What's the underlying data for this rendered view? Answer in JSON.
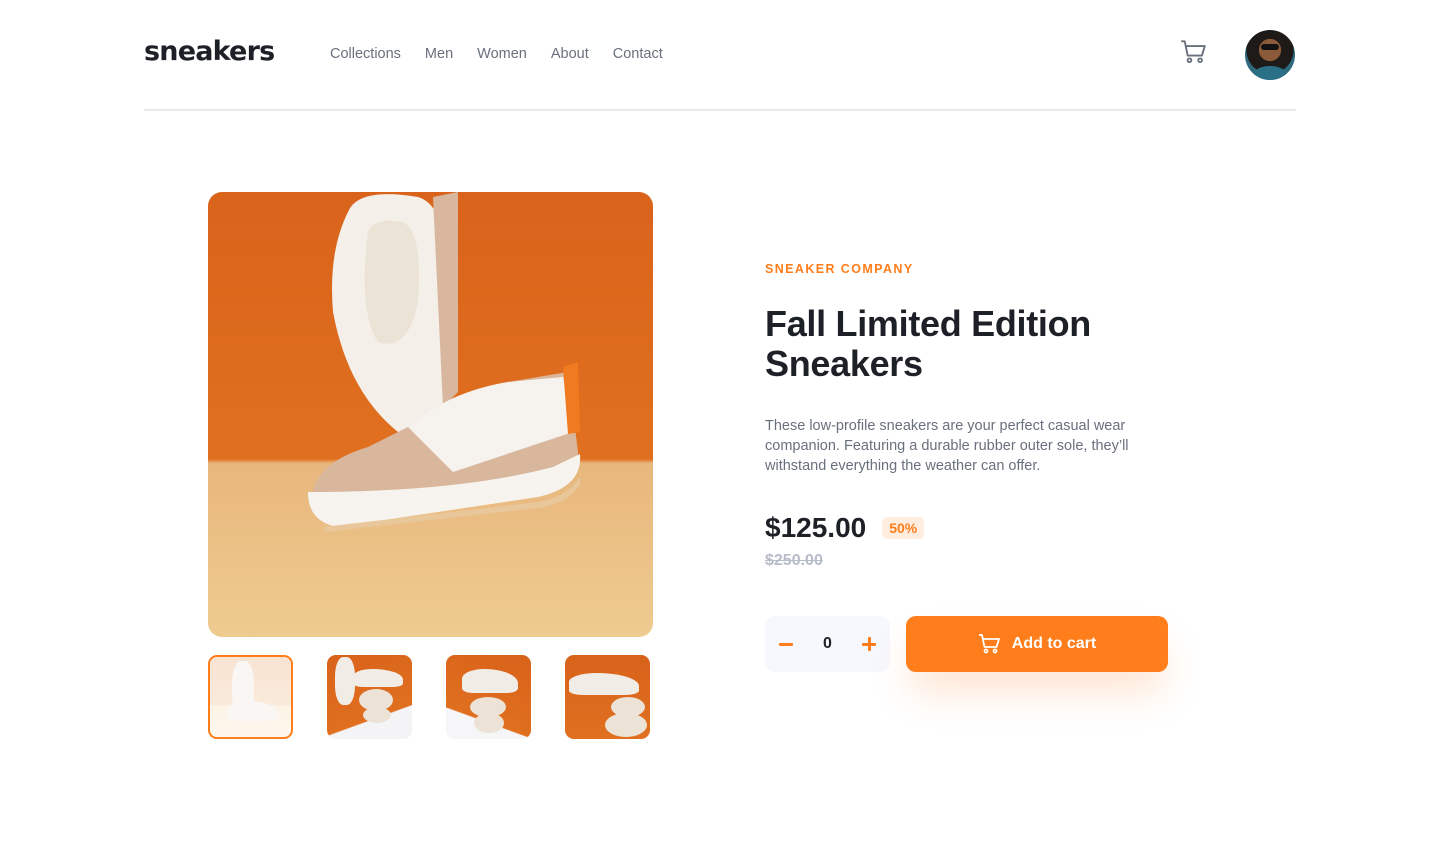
{
  "header": {
    "logo": "sneakers",
    "nav": [
      "Collections",
      "Men",
      "Women",
      "About",
      "Contact"
    ],
    "cart_icon": "cart-icon",
    "avatar": "user-avatar"
  },
  "gallery": {
    "main_image": "sneaker-product-image-1",
    "thumbnails": [
      {
        "name": "thumbnail-1",
        "active": true
      },
      {
        "name": "thumbnail-2",
        "active": false
      },
      {
        "name": "thumbnail-3",
        "active": false
      },
      {
        "name": "thumbnail-4",
        "active": false
      }
    ]
  },
  "product": {
    "brand": "SNEAKER COMPANY",
    "title": "Fall Limited Edition Sneakers",
    "description": "These low-profile sneakers are your perfect casual wear companion. Featuring a durable rubber outer sole, they’ll withstand everything the weather can offer.",
    "price": "$125.00",
    "discount": "50%",
    "original_price": "$250.00"
  },
  "cart": {
    "quantity": "0",
    "add_label": "Add to cart"
  },
  "colors": {
    "accent": "#ff7d1a",
    "accent_pale": "#ffede0",
    "text_dark": "#1d2026",
    "text_gray": "#69707d",
    "text_light": "#b6bcc8"
  }
}
